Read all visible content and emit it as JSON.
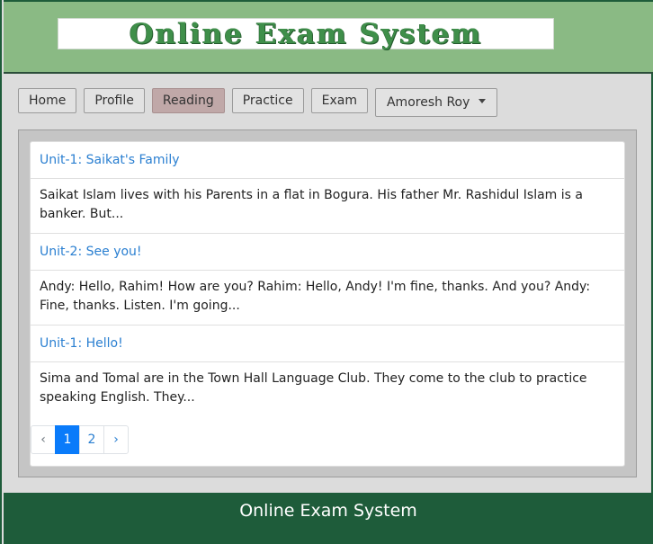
{
  "header": {
    "logo_text": "Online Exam System"
  },
  "nav": {
    "items": [
      {
        "label": "Home"
      },
      {
        "label": "Profile"
      },
      {
        "label": "Reading"
      },
      {
        "label": "Practice"
      },
      {
        "label": "Exam"
      }
    ],
    "active": "Reading",
    "user_menu_label": "Amoresh Roy"
  },
  "lessons": [
    {
      "title": "Unit-1: Saikat's Family",
      "excerpt": "Saikat Islam lives with his Parents in a flat in Bogura. His father Mr. Rashidul Islam is a banker. But..."
    },
    {
      "title": "Unit-2: See you!",
      "excerpt": "Andy: Hello, Rahim! How are you? Rahim: Hello, Andy! I'm fine, thanks. And you? Andy: Fine, thanks. Listen. I'm going..."
    },
    {
      "title": "Unit-1: Hello!",
      "excerpt": "Sima and Tomal are in the Town Hall Language Club. They come to the club to practice speaking English. They..."
    }
  ],
  "pagination": {
    "prev": "‹",
    "pages": [
      "1",
      "2"
    ],
    "current": "1",
    "next": "›"
  },
  "footer": {
    "text": "Online Exam System"
  },
  "colors": {
    "header_bg": "#8aba84",
    "footer_bg": "#1e5c3a",
    "link": "#2a7fd1",
    "active_nav": "#c0a8a8",
    "active_page": "#0a7bfa"
  }
}
